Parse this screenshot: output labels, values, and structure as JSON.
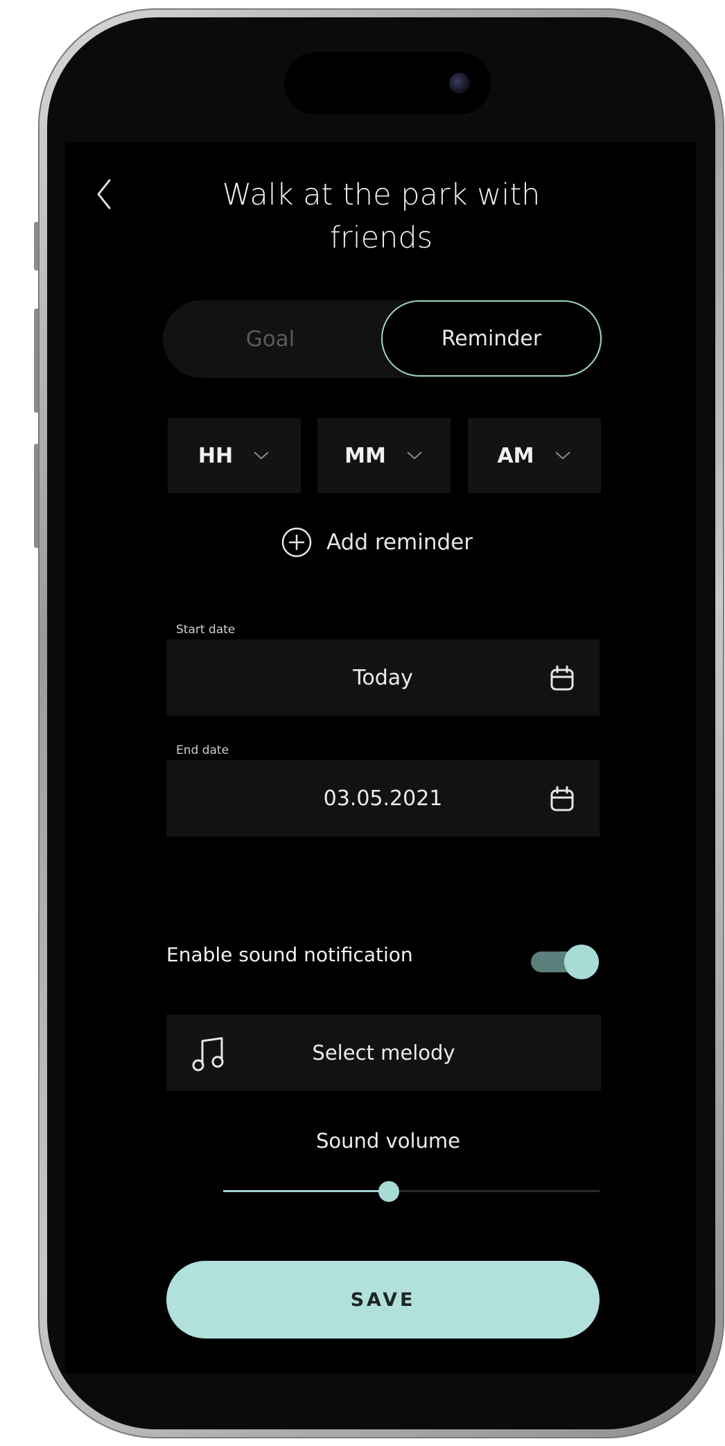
{
  "header": {
    "title_line1": "Walk at the park with",
    "title_line2": "friends",
    "back_icon": "chevron-left-icon"
  },
  "tabs": {
    "goal_label": "Goal",
    "reminder_label": "Reminder",
    "selected": "Reminder"
  },
  "time": {
    "hour": "HH",
    "minute": "MM",
    "period": "AM"
  },
  "add_reminder": {
    "label": "Add reminder",
    "icon": "plus-circle-icon"
  },
  "start_date": {
    "label": "Start date",
    "value": "Today"
  },
  "end_date": {
    "label": "End date",
    "value": "03.05.2021"
  },
  "sound": {
    "enable_label": "Enable sound notification",
    "enabled": true,
    "melody_label": "Select melody",
    "melody_icon": "music-note-icon",
    "volume_label": "Sound volume",
    "volume_fraction": 0.44
  },
  "save_label": "SAVE",
  "colors": {
    "accent": "#a7dbd5",
    "background": "#000000",
    "field": "#121212"
  }
}
